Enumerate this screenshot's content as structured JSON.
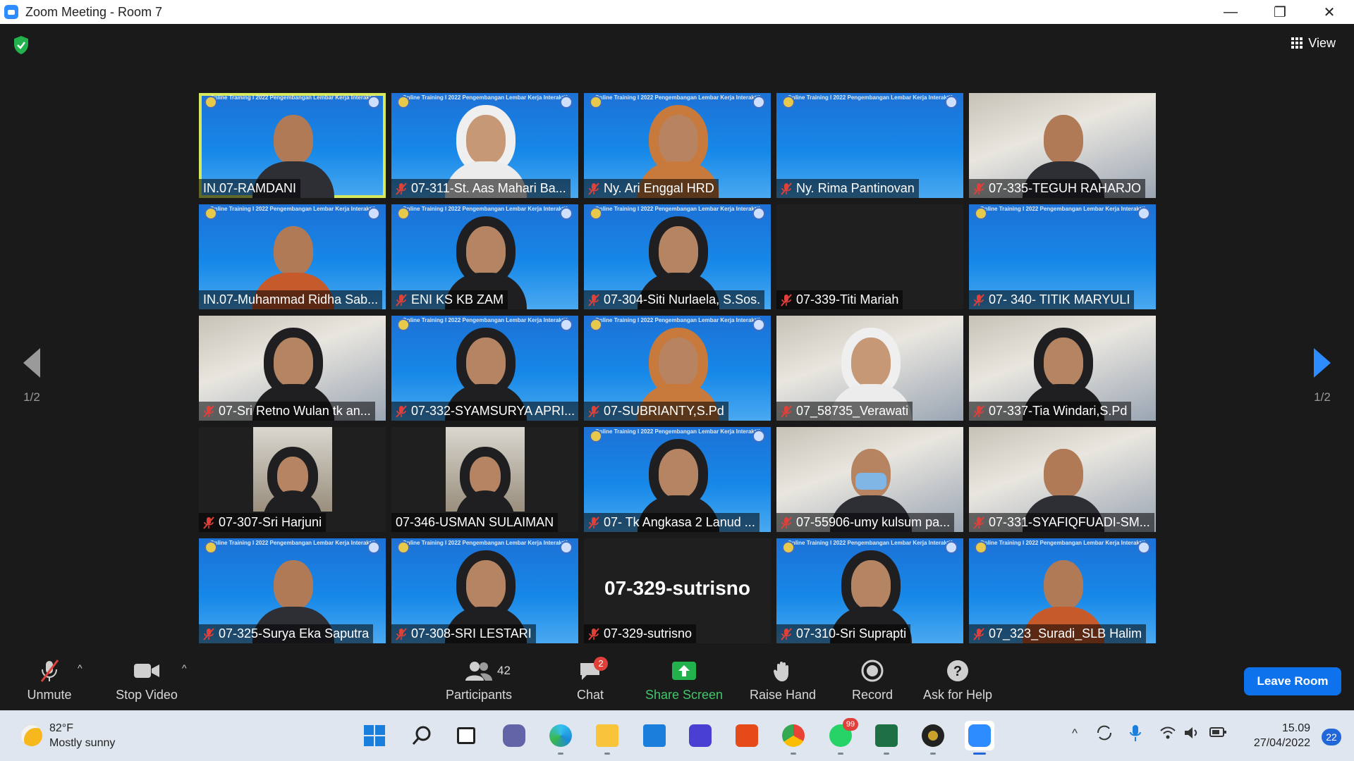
{
  "window": {
    "title": "Zoom Meeting - Room 7",
    "minimize_glyph": "—",
    "restore_glyph": "❐",
    "close_glyph": "✕"
  },
  "meeting": {
    "view_label": "View",
    "page_indicator_left": "1/2",
    "page_indicator_right": "1/2",
    "banner_text": "Online Training I 2022 Pengembangan Lembar Kerja Interaktif",
    "tiles": [
      {
        "name": "IN.07-RAMDANI",
        "muted": false
      },
      {
        "name": "07-311-St. Aas Mahari Ba...",
        "muted": true
      },
      {
        "name": "Ny. Ari Enggal HRD",
        "muted": true
      },
      {
        "name": "Ny. Rima Pantinovan",
        "muted": true
      },
      {
        "name": "07-335-TEGUH RAHARJO",
        "muted": true
      },
      {
        "name": "IN.07-Muhammad Ridha Sab...",
        "muted": false
      },
      {
        "name": "ENI KS KB ZAM",
        "muted": true
      },
      {
        "name": "07-304-Siti Nurlaela, S.Sos.",
        "muted": true
      },
      {
        "name": "07-339-Titi Mariah",
        "muted": true
      },
      {
        "name": "07- 340- TITIK MARYULI",
        "muted": true
      },
      {
        "name": "07-Sri Retno Wulan tk an...",
        "muted": true
      },
      {
        "name": "07-332-SYAMSURYA APRI...",
        "muted": true
      },
      {
        "name": "07-SUBRIANTY,S.Pd",
        "muted": true
      },
      {
        "name": "07_58735_Verawati",
        "muted": true
      },
      {
        "name": "07-337-Tia Windari,S.Pd",
        "muted": true
      },
      {
        "name": "07-307-Sri Harjuni",
        "muted": true
      },
      {
        "name": "07-346-USMAN SULAIMAN",
        "muted": false
      },
      {
        "name": "07- Tk Angkasa 2 Lanud ...",
        "muted": true
      },
      {
        "name": "07-55906-umy kulsum pa...",
        "muted": true
      },
      {
        "name": "07-331-SYAFIQFUADI-SM...",
        "muted": true
      },
      {
        "name": "07-325-Surya Eka Saputra",
        "muted": true
      },
      {
        "name": "07-308-SRI LESTARI",
        "muted": true
      },
      {
        "name": "07-329-sutrisno",
        "muted": true,
        "center_label": "07-329-sutrisno"
      },
      {
        "name": "07-310-Sri Suprapti",
        "muted": true
      },
      {
        "name": "07_323_Suradi_SLB Halim",
        "muted": true
      }
    ]
  },
  "toolbar": {
    "unmute": "Unmute",
    "stop_video": "Stop Video",
    "participants": "Participants",
    "participants_count": "42",
    "chat": "Chat",
    "chat_badge": "2",
    "share_screen": "Share Screen",
    "raise_hand": "Raise Hand",
    "record": "Record",
    "ask_for_help": "Ask for Help",
    "leave_room": "Leave Room",
    "caret": "^"
  },
  "taskbar": {
    "weather_temp": "82°F",
    "weather_desc": "Mostly sunny",
    "whatsapp_badge": "99",
    "time": "15.09",
    "date": "27/04/2022",
    "notification_count": "22",
    "tray_up_glyph": "^"
  },
  "colors": {
    "zoom_blue": "#2d8cff",
    "active_speaker": "#d7e85c",
    "share_green": "#41c66b",
    "leave_blue": "#0e72ed",
    "muted_red": "#e0403a"
  }
}
